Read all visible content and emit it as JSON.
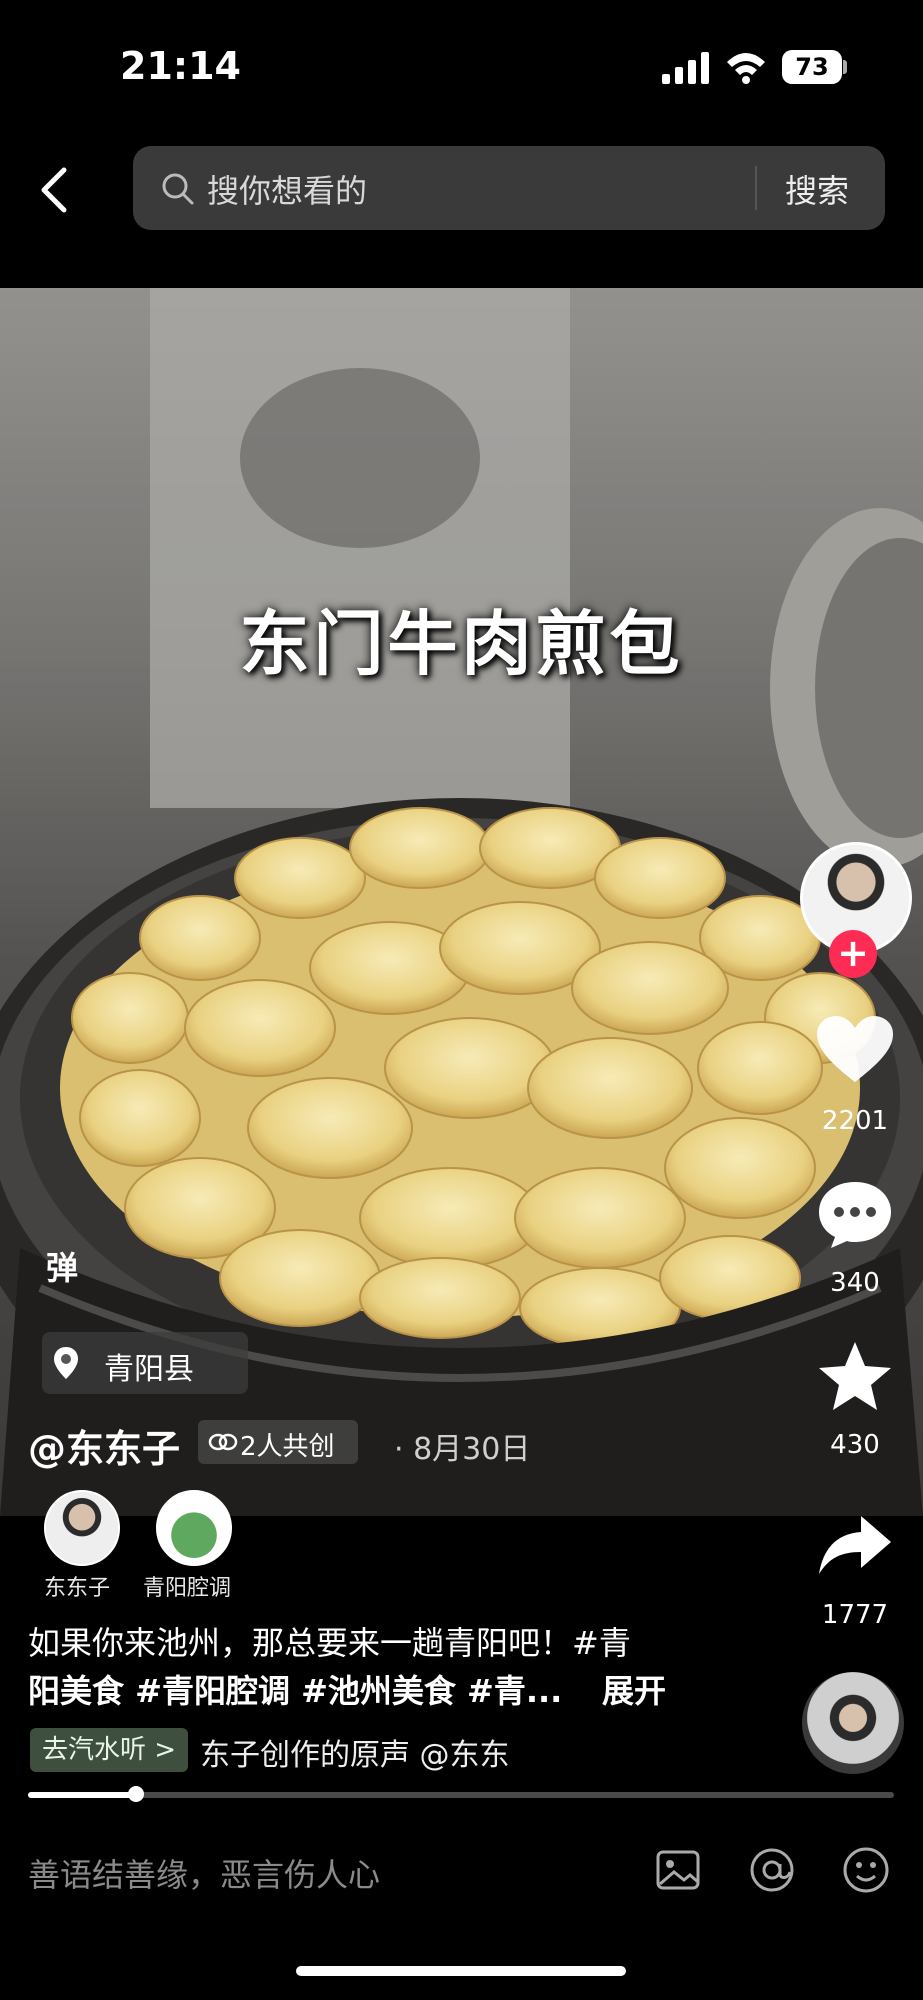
{
  "status_bar": {
    "time": "21:14",
    "battery": "73"
  },
  "search": {
    "placeholder": "搜你想看的",
    "button": "搜索"
  },
  "video": {
    "caption": "东门牛肉煎包",
    "danmu_label": "弹",
    "location": "青阳县",
    "author": "@东东子",
    "cocreate": "2人共创",
    "date": "· 8月30日"
  },
  "actions": {
    "likes": "2201",
    "comments": "340",
    "favorites": "430",
    "shares": "1777"
  },
  "creators": [
    {
      "name": "东东子"
    },
    {
      "name": "青阳腔调"
    }
  ],
  "description": {
    "line1": "如果你来池州，那总要来一趟青阳吧！#青",
    "line2": "阳美食 #青阳腔调 #池州美食 #青...",
    "expand": "展开"
  },
  "music": {
    "button": "去汽水听 >",
    "text": "东子创作的原声    @东东"
  },
  "progress": {
    "fraction": 0.125
  },
  "comment_input": {
    "placeholder": "善语结善缘，恶言伤人心"
  }
}
